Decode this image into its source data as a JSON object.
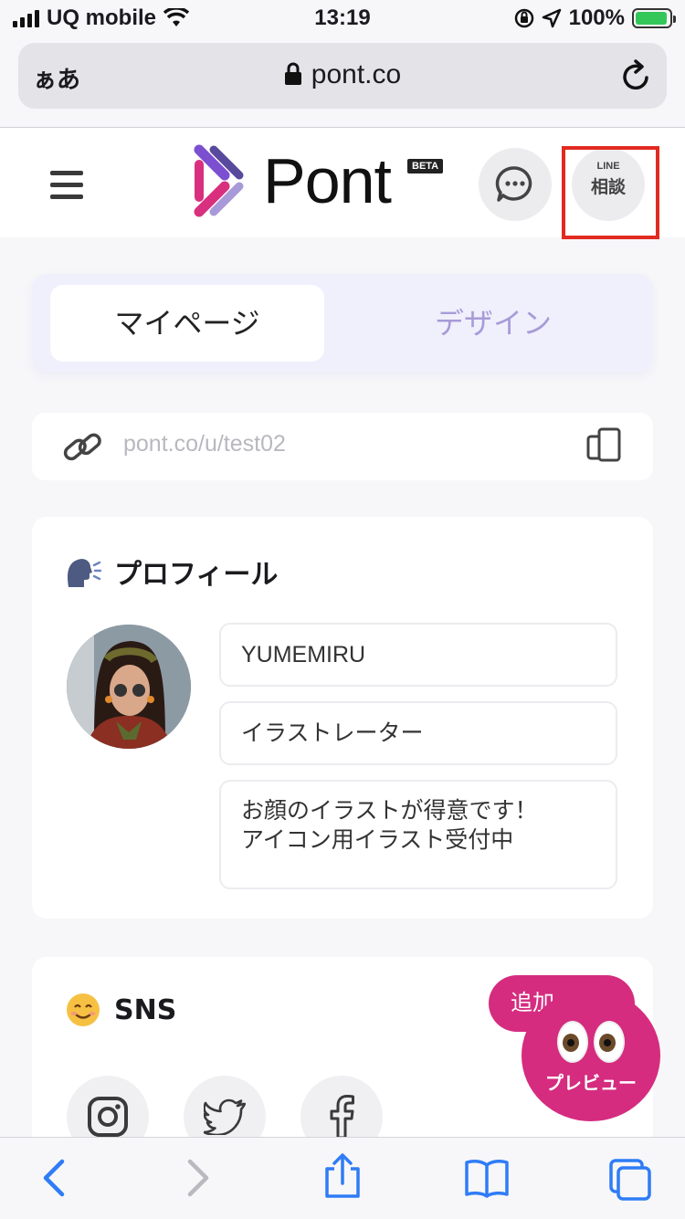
{
  "status_bar": {
    "carrier": "UQ mobile",
    "time": "13:19",
    "battery": "100%",
    "battery_level": 1.0
  },
  "browser": {
    "text_size_label": "ぁあ",
    "domain": "pont.co"
  },
  "header": {
    "logo_text": "Pont",
    "beta_badge": "BETA",
    "line_label": "LINE",
    "consult_label": "相談"
  },
  "tabs": [
    {
      "label": "マイページ",
      "active": true
    },
    {
      "label": "デザイン",
      "active": false
    }
  ],
  "profile_url": "pont.co/u/test02",
  "profile": {
    "title": "プロフィール",
    "name": "YUMEMIRU",
    "job_title": "イラストレーター",
    "bio": "お顔のイラストが得意です！\nアイコン用イラスト受付中"
  },
  "sns": {
    "title": "SNS",
    "items": [
      "instagram",
      "twitter",
      "facebook"
    ]
  },
  "floating": {
    "add_label": "追加",
    "preview_label": "プレビュー"
  },
  "colors": {
    "brand_pink": "#d52c7f",
    "tab_inactive": "#a79bd8",
    "highlight": "#e12a20",
    "ios_blue": "#2f7cf6"
  },
  "icons": [
    "signal-icon",
    "wifi-icon",
    "lock-icon",
    "location-icon",
    "battery-icon",
    "reload-icon",
    "menu-icon",
    "chat-icon",
    "link-icon",
    "copy-icon",
    "instagram-icon",
    "twitter-icon",
    "facebook-icon",
    "back-icon",
    "forward-icon",
    "share-icon",
    "bookmarks-icon",
    "tabs-icon"
  ]
}
